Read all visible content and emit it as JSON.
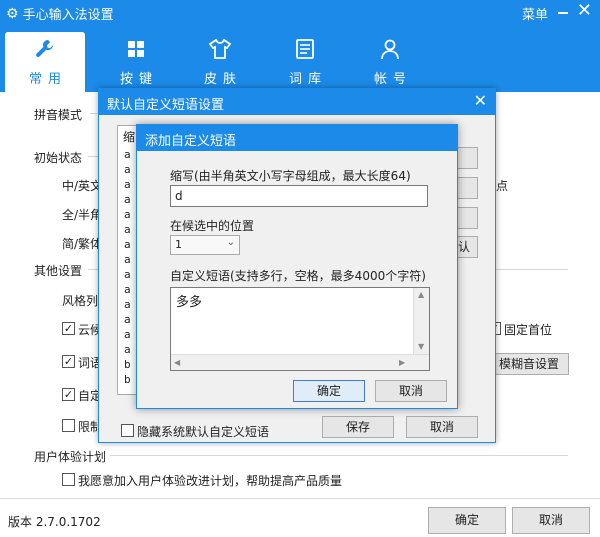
{
  "window": {
    "title": "手心输入法设置",
    "menu_label": "菜单",
    "close_glyph": "✕"
  },
  "tabs": [
    {
      "label": "常用",
      "icon": "wrench-icon",
      "active": true
    },
    {
      "label": "按键",
      "icon": "keyboard-icon",
      "active": false
    },
    {
      "label": "皮肤",
      "icon": "shirt-icon",
      "active": false
    },
    {
      "label": "词库",
      "icon": "document-icon",
      "active": false
    },
    {
      "label": "帐号",
      "icon": "user-icon",
      "active": false
    }
  ],
  "main": {
    "pinyin_mode": "拼音模式",
    "initial_state": "初始状态",
    "cn_en_partial": "中/英文",
    "full_half_partial": "全/半角",
    "simp_trad_partial": "简/繁体",
    "other_settings": "其他设置",
    "style_partial": "风格列",
    "cloud_partial": "云候",
    "words_partial": "词语",
    "auto_partial": "自定",
    "limit_partial": "限制",
    "dot_partial": "点",
    "fixed_first": "固定首位",
    "fuzzy_button": "模糊音设置",
    "user_plan_title": "用户体验计划",
    "user_plan_check": "我愿意加入用户体验改进计划，帮助提高产品质量",
    "version": "版本 2.7.0.1702",
    "ok_button": "确定",
    "cancel_button": "取消"
  },
  "dialog1": {
    "title": "默认自定义短语设置",
    "list_header": "缩",
    "list_items": [
      "a",
      "a",
      "a",
      "a",
      "a",
      "a",
      "a",
      "a",
      "a",
      "a",
      "a",
      "a",
      "a",
      "a",
      "b",
      "b"
    ],
    "side_button_partial": "认",
    "hide_default_label": "隐藏系统默认自定义短语",
    "save_button": "保存",
    "cancel_button": "取消"
  },
  "dialog2": {
    "title": "添加自定义短语",
    "abbr_label": "缩写(由半角英文小写字母组成，最大长度64)",
    "abbr_value": "d",
    "position_label": "在候选中的位置",
    "position_value": "1",
    "phrase_label": "自定义短语(支持多行，空格，最多4000个字符)",
    "phrase_value": "多多",
    "ok_button": "确定",
    "cancel_button": "取消"
  },
  "colors": {
    "accent": "#1b8ae8"
  }
}
